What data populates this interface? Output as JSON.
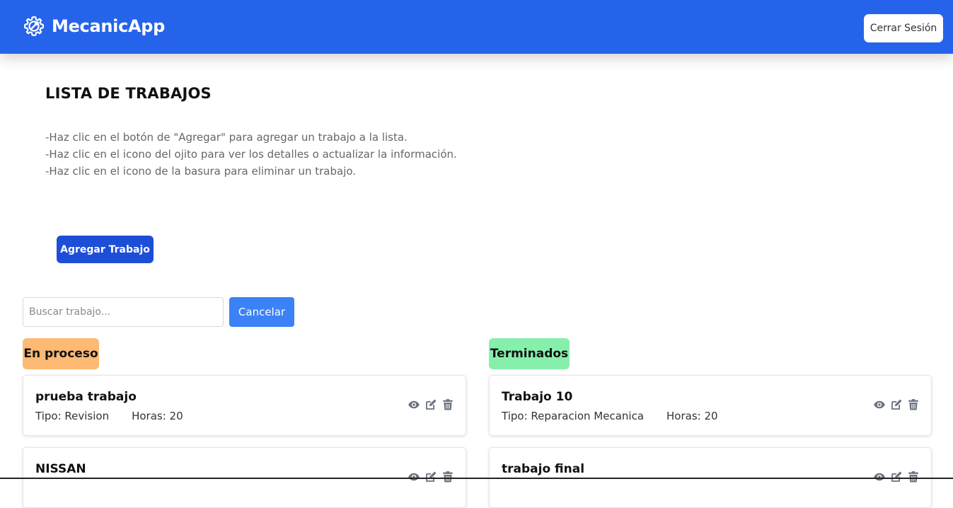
{
  "app": {
    "name": "MecanicApp",
    "logo_icon": "gear-wrench-icon"
  },
  "header": {
    "logout_label": "Cerrar Sesión"
  },
  "page": {
    "title": "LISTA DE TRABAJOS",
    "instructions": [
      "-Haz clic en el botón de \"Agregar\" para agregar un trabajo a la lista.",
      "-Haz clic en el icono del ojito para ver los detalles o actualizar la información.",
      "-Haz clic en el icono de la basura para eliminar un trabajo."
    ],
    "add_button_label": "Agregar Trabajo"
  },
  "search": {
    "placeholder": "Buscar trabajo...",
    "value": "",
    "cancel_label": "Cancelar"
  },
  "columns": {
    "in_progress": {
      "label": "En proceso",
      "color": "#fdba74",
      "jobs": [
        {
          "name": "prueba trabajo",
          "tipo": "Tipo: Revision",
          "horas": "Horas: 20"
        },
        {
          "name": "NISSAN",
          "tipo": "",
          "horas": ""
        }
      ]
    },
    "finished": {
      "label": "Terminados",
      "color": "#86efac",
      "jobs": [
        {
          "name": "Trabajo 10",
          "tipo": "Tipo: Reparacion Mecanica",
          "horas": "Horas: 20"
        },
        {
          "name": "trabajo final",
          "tipo": "",
          "horas": ""
        }
      ]
    }
  },
  "colors": {
    "primary": "#2563eb",
    "add_button": "#1d4ed8",
    "cancel_button": "#3b82f6",
    "action_icon": "#6b7280"
  }
}
